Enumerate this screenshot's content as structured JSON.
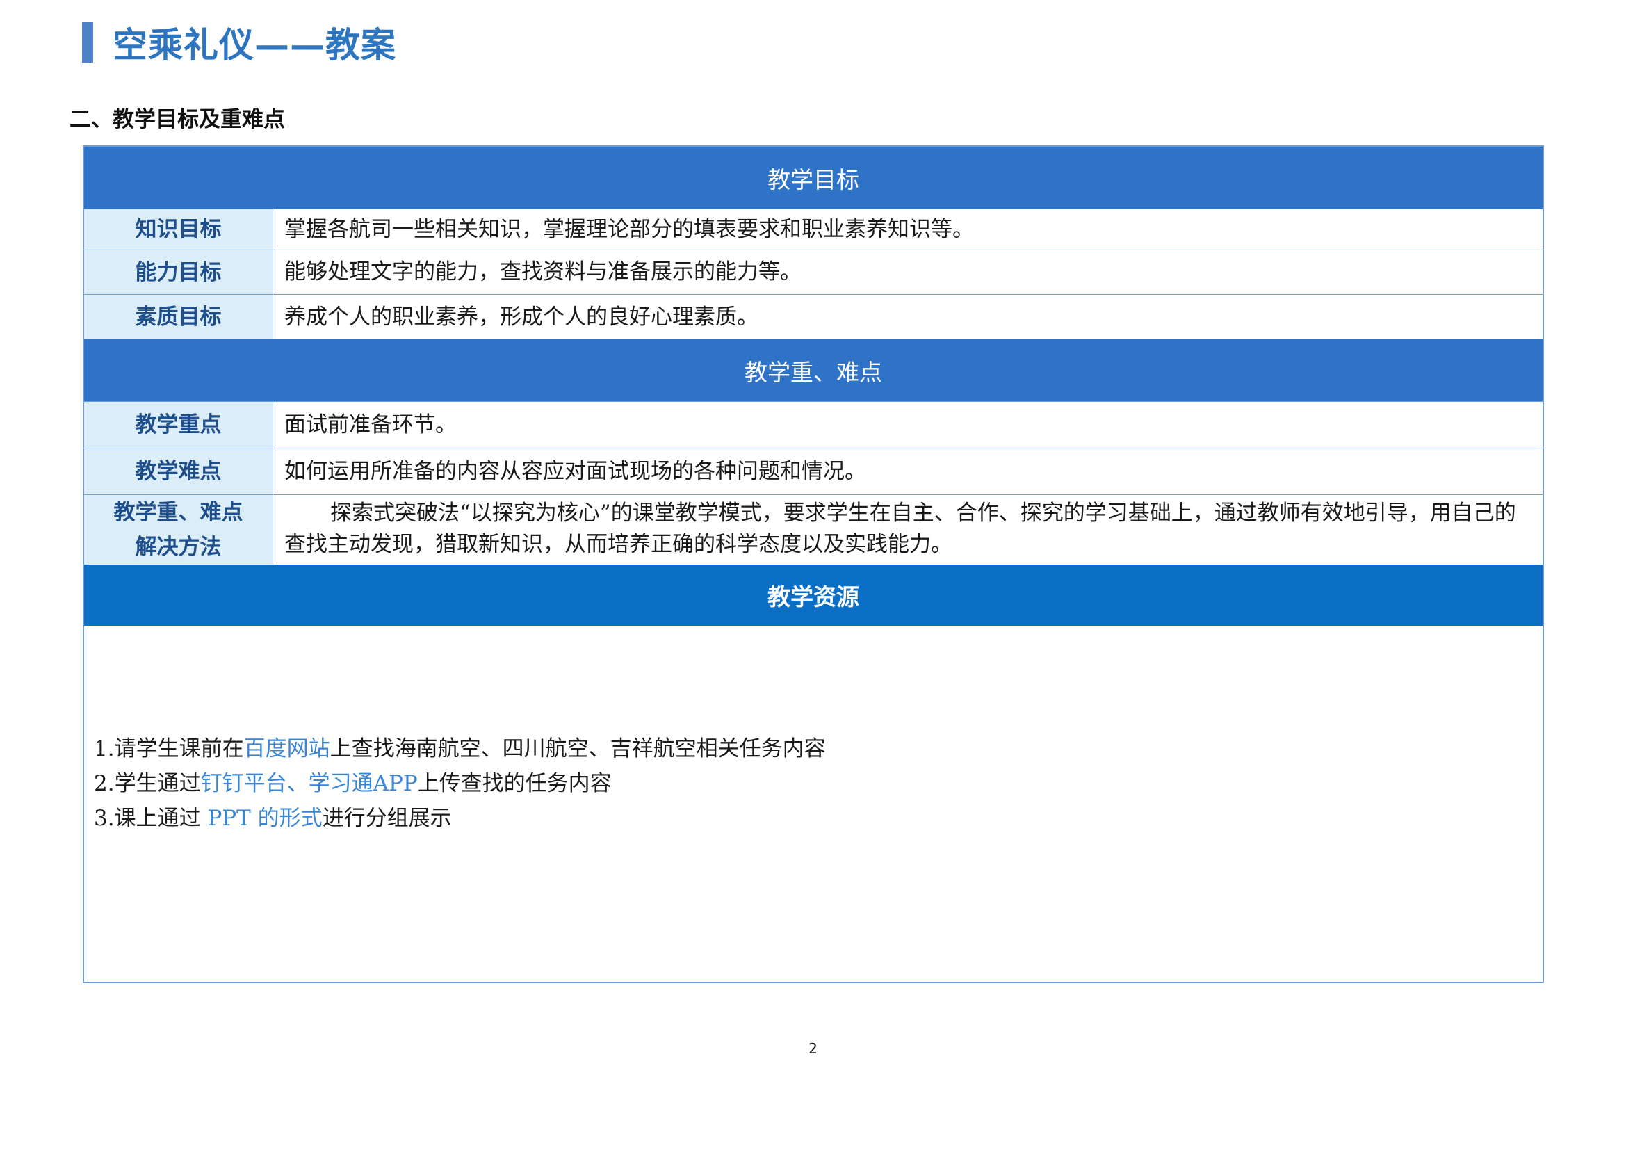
{
  "title": "空乘礼仪——教案",
  "section_heading": "二、教学目标及重难点",
  "goals_header": "教学目标",
  "goals": [
    {
      "label": "知识目标",
      "value": "掌握各航司一些相关知识，掌握理论部分的填表要求和职业素养知识等。"
    },
    {
      "label": "能力目标",
      "value": "能够处理文字的能力，查找资料与准备展示的能力等。"
    },
    {
      "label": "素质目标",
      "value": "养成个人的职业素养，形成个人的良好心理素质。"
    }
  ],
  "key_points_header": "教学重、难点",
  "key_points": [
    {
      "label": "教学重点",
      "value": "面试前准备环节。"
    },
    {
      "label": "教学难点",
      "value": "如何运用所准备的内容从容应对面试现场的各种问题和情况。"
    }
  ],
  "method": {
    "label_line1": "教学重、难点",
    "label_line2": "解决方法",
    "value": "探索式突破法“以探究为核心”的课堂教学模式，要求学生在自主、合作、探究的学习基础上，通过教师有效地引导，用自己的查找主动发现，猎取新知识，从而培养正确的科学态度以及实践能力。"
  },
  "resources_header": "教学资源",
  "resources": [
    {
      "before": "1.请学生课前在",
      "highlight": "百度网站",
      "after": "上查找海南航空、四川航空、吉祥航空相关任务内容"
    },
    {
      "before": "2.学生通过",
      "highlight": "钉钉平台、学习通APP",
      "after": "上传查找的任务内容"
    },
    {
      "before": "3.课上通过 ",
      "highlight": "PPT 的形式",
      "after": "进行分组展示"
    }
  ],
  "page_number": "2",
  "colors": {
    "accent": "#2e75c0",
    "band": "#2f73c9",
    "label_bg": "#dbeef7",
    "link": "#3a86d4"
  }
}
